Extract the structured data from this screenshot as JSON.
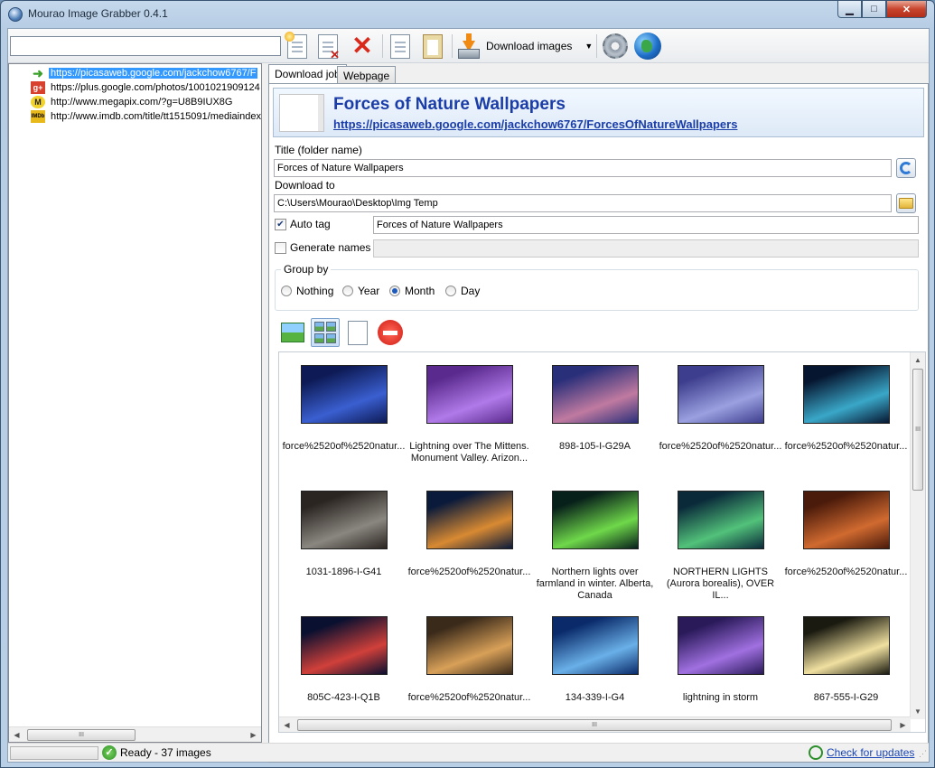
{
  "window": {
    "title": "Mourao Image Grabber 0.4.1"
  },
  "toolbar": {
    "url_value": "",
    "download_label": "Download images"
  },
  "tree": {
    "items": [
      {
        "icon": "arrow-icon",
        "url": "https://picasaweb.google.com/jackchow6767/F",
        "selected": true
      },
      {
        "icon": "google-plus-icon",
        "url": "https://plus.google.com/photos/1001021909124",
        "selected": false
      },
      {
        "icon": "megapix-icon",
        "url": "http://www.megapix.com/?g=U8B9IUX8G",
        "selected": false
      },
      {
        "icon": "imdb-icon",
        "url": "http://www.imdb.com/title/tt1515091/mediaindex",
        "selected": false
      }
    ],
    "icon_labels": {
      "gplus": "g+",
      "megapix": "M",
      "imdb": "IMDb"
    }
  },
  "tabs": [
    {
      "label": "Download job",
      "active": true
    },
    {
      "label": "Webpage",
      "active": false
    }
  ],
  "job": {
    "title": "Forces of Nature Wallpapers",
    "url": "https://picasaweb.google.com/jackchow6767/ForcesOfNatureWallpapers",
    "title_label": "Title (folder name)",
    "title_value": "Forces of Nature Wallpapers",
    "download_to_label": "Download to",
    "download_to_value": "C:\\Users\\Mourao\\Desktop\\Img Temp",
    "auto_tag_label": "Auto tag",
    "auto_tag_checked": true,
    "auto_tag_value": "Forces of Nature Wallpapers",
    "generate_names_label": "Generate names",
    "generate_names_checked": false,
    "group_by_label": "Group by",
    "group_options": [
      "Nothing",
      "Year",
      "Month",
      "Day"
    ],
    "group_selected": "Month"
  },
  "gallery": {
    "items": [
      {
        "caption": "force%2520of%2520natur...",
        "colors": [
          "#0d1a55",
          "#3a5fd0"
        ]
      },
      {
        "caption": "Lightning over The Mittens. Monument Valley. Arizon...",
        "colors": [
          "#5a2a8e",
          "#b07ae8"
        ]
      },
      {
        "caption": "898-105-I-G29A",
        "colors": [
          "#2a2f7a",
          "#c07aa0"
        ]
      },
      {
        "caption": "force%2520of%2520natur...",
        "colors": [
          "#3e3e8e",
          "#9aa0e0"
        ]
      },
      {
        "caption": "force%2520of%2520natur...",
        "colors": [
          "#061630",
          "#3aa7c8"
        ]
      },
      {
        "caption": "1031-1896-I-G41",
        "colors": [
          "#2a2520",
          "#8a8680"
        ]
      },
      {
        "caption": "force%2520of%2520natur...",
        "colors": [
          "#0a1a3a",
          "#d88a32"
        ]
      },
      {
        "caption": "Northern lights over farmland in winter. Alberta, Canada",
        "colors": [
          "#08201a",
          "#6fd84a"
        ]
      },
      {
        "caption": "NORTHERN LIGHTS (Aurora borealis), OVER IL...",
        "colors": [
          "#0a2a3a",
          "#52c27a"
        ]
      },
      {
        "caption": "force%2520of%2520natur...",
        "colors": [
          "#4a1a0a",
          "#d06a30"
        ]
      },
      {
        "caption": "805C-423-I-Q1B",
        "colors": [
          "#0a1030",
          "#d0403a"
        ]
      },
      {
        "caption": "force%2520of%2520natur...",
        "colors": [
          "#3a2a1a",
          "#d8a058"
        ]
      },
      {
        "caption": "134-339-I-G4",
        "colors": [
          "#0a2a6a",
          "#6ab0e8"
        ]
      },
      {
        "caption": "lightning in storm",
        "colors": [
          "#2a1a5a",
          "#a070e0"
        ]
      },
      {
        "caption": "867-555-I-G29",
        "colors": [
          "#1a1a10",
          "#f0e0a0"
        ]
      }
    ]
  },
  "status": {
    "text": "Ready - 37 images",
    "update_link": "Check for updates"
  },
  "scroll": {
    "grip": "III"
  }
}
